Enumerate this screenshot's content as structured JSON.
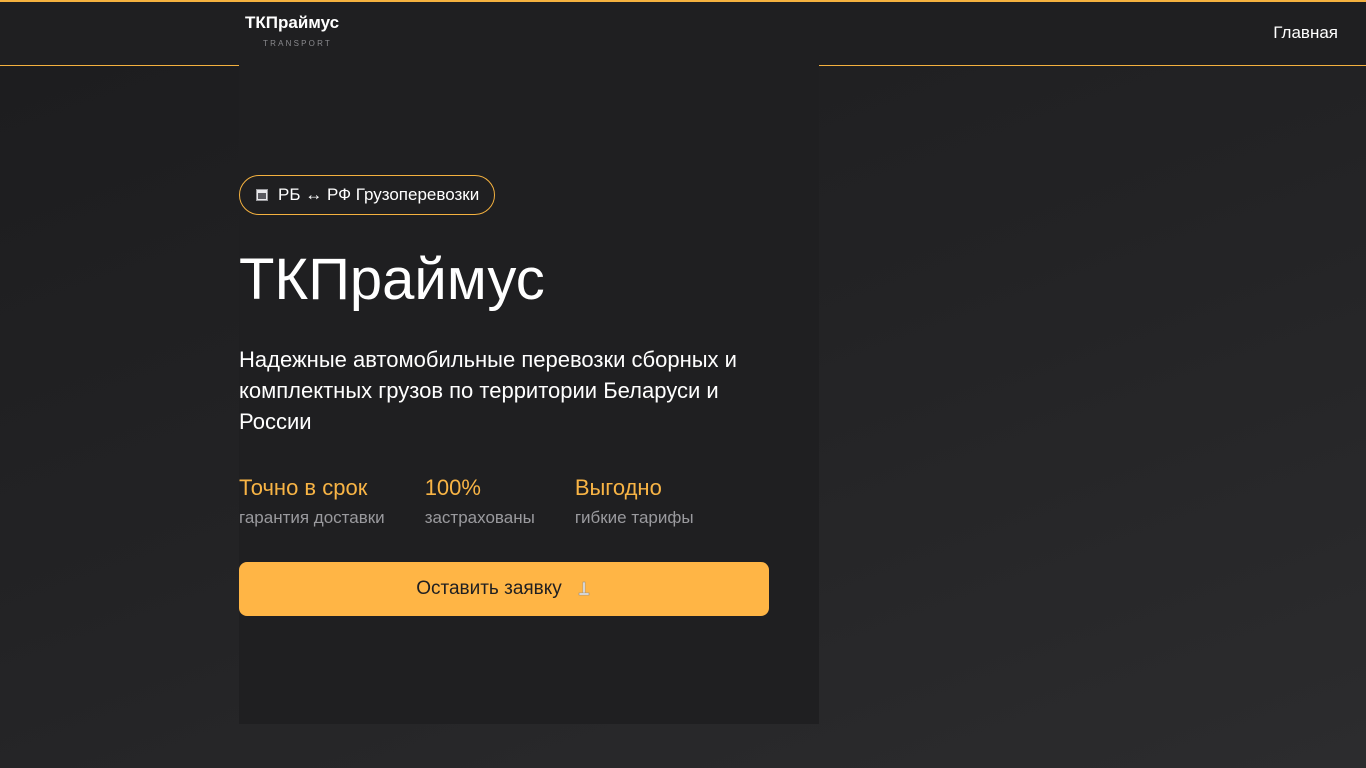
{
  "header": {
    "logo_title": "ТКПраймус",
    "logo_subtitle": "TRANSPORT",
    "nav_home": "Главная"
  },
  "hero": {
    "badge": "РБ ↔ РФ Грузоперевозки",
    "badge_icon": "truck-icon",
    "title": "ТКПраймус",
    "description": "Надежные автомобильные перевозки сборных и комплектных грузов по территории Беларуси и России",
    "stats": [
      {
        "value": "Точно в срок",
        "caption": "гарантия доставки"
      },
      {
        "value": "100%",
        "caption": "застрахованы"
      },
      {
        "value": "Выгодно",
        "caption": "гибкие тарифы"
      }
    ],
    "cta_label": "Оставить заявку",
    "cta_icon": "arrow-down-icon"
  },
  "colors": {
    "accent": "#ffb545",
    "background": "#1f1f21",
    "muted_text": "#9a9a9e"
  }
}
